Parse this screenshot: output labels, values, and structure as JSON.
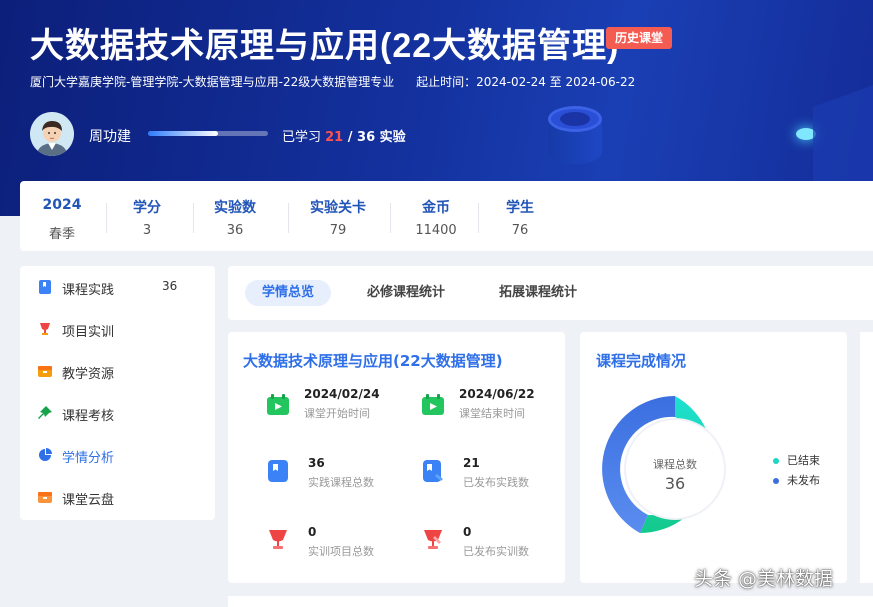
{
  "header": {
    "title": "大数据技术原理与应用(22大数据管理)",
    "badge": "历史课堂",
    "org": "厦门大学嘉庚学院-管理学院-大数据管理与应用-22级大数据管理专业",
    "time_label": "起止时间：",
    "time_range": "2024-02-24 至 2024-06-22"
  },
  "user": {
    "name": "周功建",
    "learned_prefix": "已学习 ",
    "learned_count": "21",
    "learned_suffix": " / 36 实验",
    "progress_fraction": 0.58
  },
  "stats": [
    {
      "key": "2024",
      "value": "春季"
    },
    {
      "key": "学分",
      "value": "3"
    },
    {
      "key": "实验数",
      "value": "36"
    },
    {
      "key": "实验关卡",
      "value": "79"
    },
    {
      "key": "金币",
      "value": "11400"
    },
    {
      "key": "学生",
      "value": "76"
    }
  ],
  "sidebar": {
    "items": [
      {
        "label": "课程实践",
        "count": "36",
        "icon": "book-icon",
        "color": "#3b82f6"
      },
      {
        "label": "项目实训",
        "count": "",
        "icon": "trophy-icon",
        "color": "#ef4444"
      },
      {
        "label": "教学资源",
        "count": "",
        "icon": "box-icon",
        "color": "#f59e0b"
      },
      {
        "label": "课程考核",
        "count": "",
        "icon": "pin-icon",
        "color": "#16a34a"
      },
      {
        "label": "学情分析",
        "count": "",
        "icon": "pie-icon",
        "color": "#2f6fe8",
        "active": true
      },
      {
        "label": "课堂云盘",
        "count": "",
        "icon": "cloud-box-icon",
        "color": "#f97316"
      }
    ]
  },
  "tabs": [
    {
      "label": "学情总览",
      "active": true
    },
    {
      "label": "必修课程统计",
      "active": false
    },
    {
      "label": "拓展课程统计",
      "active": false
    }
  ],
  "course_card": {
    "title": "大数据技术原理与应用(22大数据管理)",
    "cells": [
      {
        "value": "2024/02/24",
        "label": "课堂开始时间",
        "icon": "calendar-icon"
      },
      {
        "value": "2024/06/22",
        "label": "课堂结束时间",
        "icon": "calendar-icon"
      },
      {
        "value": "36",
        "label": "实践课程总数",
        "icon": "doc-icon"
      },
      {
        "value": "21",
        "label": "已发布实践数",
        "icon": "doc-upload-icon"
      },
      {
        "value": "0",
        "label": "实训项目总数",
        "icon": "trophy-icon"
      },
      {
        "value": "0",
        "label": "已发布实训数",
        "icon": "trophy-upload-icon"
      }
    ]
  },
  "completion_card": {
    "title": "课程完成情况",
    "center_label": "课程总数",
    "center_value": "36",
    "legend": [
      {
        "label": "已结束",
        "color": "#1fd6c4"
      },
      {
        "label": "未发布",
        "color": "#3b6fe0"
      }
    ]
  },
  "watermark": "头条 @美林数据"
}
